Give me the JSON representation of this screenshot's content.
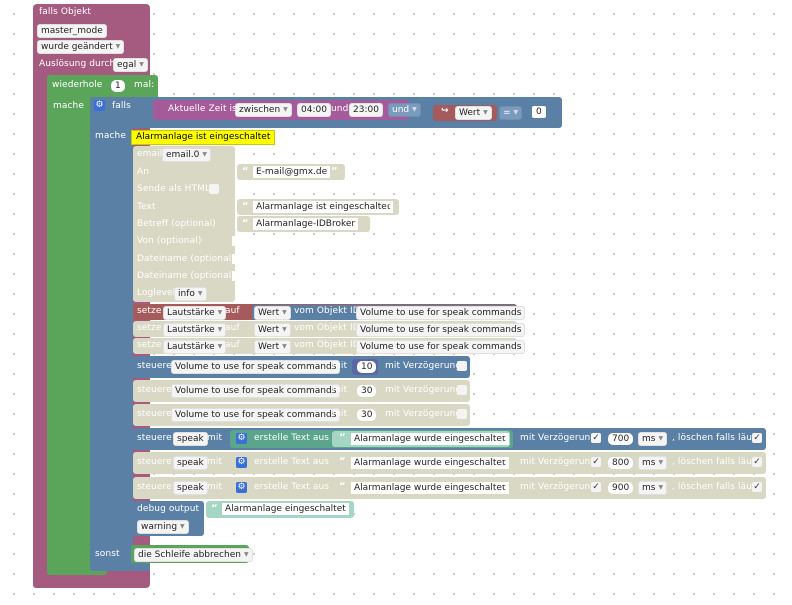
{
  "trigger": {
    "title": "falls Objekt",
    "object": "master_mode",
    "condition": "wurde geändert",
    "trigger_label": "Auslösung durch",
    "trigger_value": "egal"
  },
  "loop": {
    "repeat_label": "wiederhole",
    "repeat_count": "1",
    "times_label": "mal:",
    "do_label": "mache",
    "else_label": "sonst",
    "break_label": "die Schleife abbrechen"
  },
  "ifblock": {
    "if_label": "falls",
    "do_label": "mache",
    "time_label": "Aktuelle Zeit ist",
    "time_op": "zwischen",
    "time_from": "04:00",
    "and_label": "und",
    "time_to": "23:00",
    "logic_op": "und",
    "value_label": "Wert",
    "compare_op": "=",
    "compare_value": "0"
  },
  "email": {
    "comment": "Alarmanlage ist eingeschaltet",
    "email_label": "email",
    "email_instance": "email.0",
    "to_label": "An",
    "to_value": "E-mail@gmx.de",
    "html_label": "Sende als HTML",
    "text_label": "Text",
    "text_value": "Alarmanlage ist eingeschaltet",
    "subject_label": "Betreff (optional)",
    "subject_value": "Alarmanlage-IDBroker",
    "from_label": "Von (optional)",
    "file1_label": "Dateiname (optional)",
    "file2_label": "Dateiname (optional)",
    "loglevel_label": "Loglevel",
    "loglevel_value": "info"
  },
  "set_blocks": [
    {
      "set": "setze",
      "var": "Lautstärke",
      "on": "auf",
      "value": "Wert",
      "from": "vom Objekt ID",
      "object": "Volume to use for speak commands"
    },
    {
      "set": "setze",
      "var": "Lautstärke",
      "on": "auf",
      "value": "Wert",
      "from": "vom Objekt ID",
      "object": "Volume to use for speak commands"
    },
    {
      "set": "setze",
      "var": "Lautstärke",
      "on": "auf",
      "value": "Wert",
      "from": "vom Objekt ID",
      "object": "Volume to use for speak commands"
    }
  ],
  "control_blocks": [
    {
      "label": "steuere",
      "object": "Volume to use for speak commands",
      "with": "mit",
      "value": "10",
      "delay": "mit Verzögerung"
    },
    {
      "label": "steuere",
      "object": "Volume to use for speak commands",
      "with": "mit",
      "value": "30",
      "delay": "mit Verzögerung"
    },
    {
      "label": "steuere",
      "object": "Volume to use for speak commands",
      "with": "mit",
      "value": "30",
      "delay": "mit Verzögerung"
    }
  ],
  "speak_blocks": [
    {
      "label": "steuere",
      "object": "speak",
      "with": "mit",
      "create": "erstelle Text aus",
      "text": "Alarmanlage wurde eingeschaltet",
      "delay": "mit Verzögerung",
      "delay_value": "700",
      "unit": "ms",
      "clear": ", löschen falls läuft"
    },
    {
      "label": "steuere",
      "object": "speak",
      "with": "mit",
      "create": "erstelle Text aus",
      "text": "Alarmanlage wurde eingeschaltet",
      "delay": "mit Verzögerung",
      "delay_value": "800",
      "unit": "ms",
      "clear": ", löschen falls läuft"
    },
    {
      "label": "steuere",
      "object": "speak",
      "with": "mit",
      "create": "erstelle Text aus",
      "text": "Alarmanlage wurde eingeschaltet",
      "delay": "mit Verzögerung",
      "delay_value": "900",
      "unit": "ms",
      "clear": ", löschen falls läuft"
    }
  ],
  "debug": {
    "label": "debug output",
    "text": "Alarmanlage eingeschaltet",
    "level": "warning"
  },
  "colors": {
    "trigger": "#a55b80",
    "loop": "#5ba55b",
    "logic": "#5b80a5",
    "time": "#a55b9a",
    "email_disabled": "#d8d8c4",
    "value": "#a55b5b",
    "comment": "#fdfd00",
    "text_block": "#a5d6c4"
  },
  "icons": [
    "gear-icon",
    "arrow-icon",
    "checkbox-icon",
    "quote-icon",
    "dropdown-arrow-icon"
  ]
}
